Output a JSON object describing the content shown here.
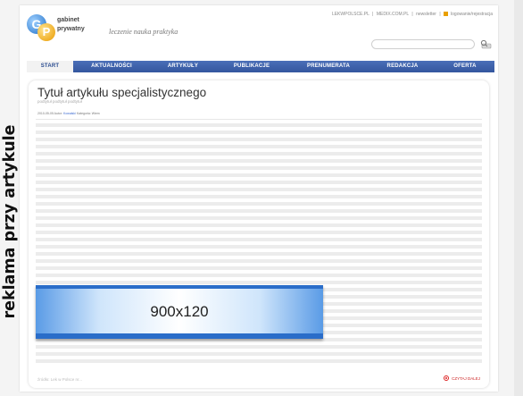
{
  "side_label": "reklama przy artykule",
  "header": {
    "logo_line1": "gabinet",
    "logo_line2": "prywatny",
    "logo_letter_g": "G",
    "logo_letter_p": "P",
    "tagline": "leczenie nauka praktyka",
    "top_links": [
      "LEKWPOLSCE.PL",
      "MEDIX.COM.PL",
      "newsletter",
      "logowanie/rejestracja"
    ],
    "search_placeholder": ""
  },
  "nav": {
    "items": [
      {
        "label": "START",
        "active": true
      },
      {
        "label": "AKTUALNOŚCI",
        "active": false
      },
      {
        "label": "ARTYKUŁY",
        "active": false
      },
      {
        "label": "PUBLIKACJE",
        "active": false
      },
      {
        "label": "PRENUMERATA",
        "active": false
      },
      {
        "label": "REDAKCJA",
        "active": false
      },
      {
        "label": "OFERTA",
        "active": false
      }
    ]
  },
  "article": {
    "title": "Tytuł artykułu specjalistycznego",
    "subtitle": "podtytuł podtytuł podtytuł",
    "meta_date": "2010-05-05 Autor:",
    "meta_author": "Kowalski",
    "meta_tail": "Kategoria: Wiem",
    "ad_banner_text": "900x120",
    "source": "źródło: Lek w Polsce nr...",
    "read_more": "CZYTAJ DALEJ"
  },
  "colors": {
    "nav_bar": "#3d5fa8",
    "accent_orange": "#e99a00",
    "ad_blue": "#2a6dc9"
  }
}
